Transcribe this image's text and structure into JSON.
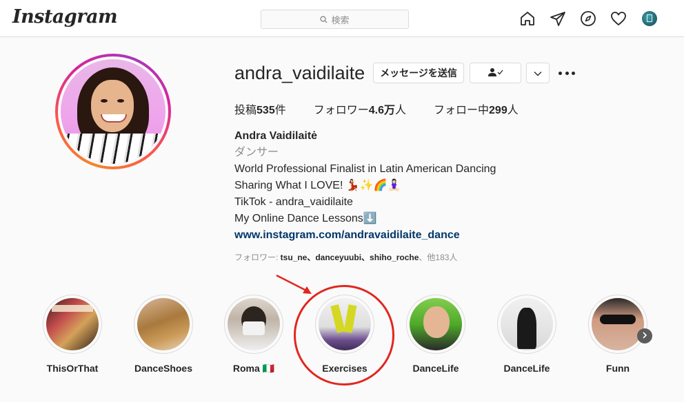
{
  "nav": {
    "logo": "Instagram",
    "search_placeholder": "検索",
    "icons": [
      "home-icon",
      "direct-icon",
      "explore-icon",
      "heart-icon",
      "avatar"
    ]
  },
  "profile": {
    "username": "andra_vaidilaite",
    "message_button": "メッセージを送信",
    "follow_state_icon": "user-check-icon",
    "stats": {
      "posts_label": "投稿",
      "posts_value": "535",
      "posts_unit": "件",
      "followers_label": "フォロワー",
      "followers_value": "4.6万",
      "followers_unit": "人",
      "following_label": "フォロー中",
      "following_value": "299",
      "following_unit": "人"
    },
    "bio": {
      "name": "Andra Vaidilaitė",
      "category": "ダンサー",
      "line1": "World Professional Finalist in Latin American Dancing",
      "line2": "Sharing What I LOVE! 💃🏻✨🌈🧘🏻‍♀️",
      "line3": "TikTok - andra_vaidilaite",
      "line4": "My Online Dance Lessons⬇️",
      "link": "www.instagram.com/andravaidilaite_dance"
    },
    "followed_by": {
      "prefix": "フォロワー: ",
      "names": "tsu_ne、danceyuubi、shiho_roche",
      "suffix": "、他183人"
    }
  },
  "highlights": [
    {
      "label": "ThisOrThat"
    },
    {
      "label": "DanceShoes"
    },
    {
      "label": "Roma 🇮🇹"
    },
    {
      "label": "Exercises"
    },
    {
      "label": "DanceLife"
    },
    {
      "label": "DanceLife"
    },
    {
      "label": "Funn"
    }
  ],
  "colors": {
    "annotation": "#e2261f",
    "link": "#00376b",
    "muted": "#8e8e8e",
    "border": "#dbdbdb"
  }
}
